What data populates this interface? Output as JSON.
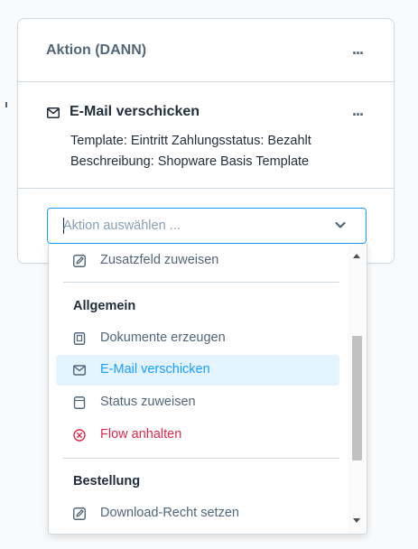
{
  "card": {
    "title": "Aktion (DANN)",
    "menu_label": "...",
    "sequence": {
      "icon": "mail-icon",
      "title": "E-Mail verschicken",
      "menu_label": "...",
      "template_line": "Template: Eintritt Zahlungsstatus: Bezahlt",
      "description_line": "Beschreibung: Shopware Basis Template"
    }
  },
  "select": {
    "placeholder": "Aktion auswählen ...",
    "chevron_icon": "chevron-down-icon"
  },
  "dropdown": {
    "items": [
      {
        "label": "Zusatzfeld zuweisen",
        "icon": "pencil-icon"
      },
      {
        "label": "Dokumente erzeugen",
        "icon": "document-icon"
      },
      {
        "label": "E-Mail verschicken",
        "icon": "mail-icon",
        "selected": true
      },
      {
        "label": "Status zuweisen",
        "icon": "status-icon"
      },
      {
        "label": "Flow anhalten",
        "icon": "stop-circle-icon"
      },
      {
        "label": "Download-Recht setzen",
        "icon": "pencil-icon"
      }
    ],
    "groups": {
      "allgemein": "Allgemein",
      "bestellung": "Bestellung"
    }
  },
  "colors": {
    "accent": "#189eff",
    "selected_bg": "#e3f3ff",
    "danger": "#de294c",
    "text": "#52667a",
    "text_dark": "#1f2d3d",
    "border": "#d1d9e0"
  }
}
